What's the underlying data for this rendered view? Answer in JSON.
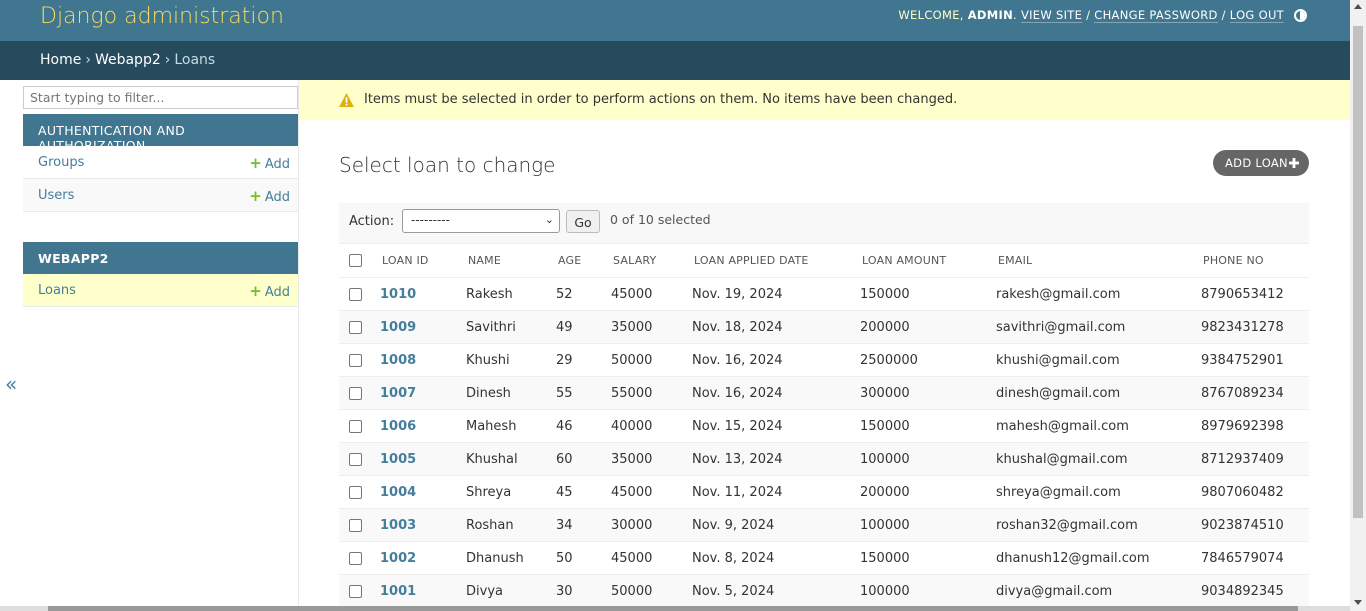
{
  "header": {
    "site_name": "Django administration",
    "welcome": "WELCOME, ",
    "username": "ADMIN",
    "view_site": "VIEW SITE",
    "change_password": "CHANGE PASSWORD",
    "log_out": "LOG OUT"
  },
  "breadcrumbs": {
    "home": "Home",
    "app": "Webapp2",
    "current": "Loans"
  },
  "sidebar": {
    "filter_placeholder": "Start typing to filter...",
    "apps": [
      {
        "caption": "AUTHENTICATION AND AUTHORIZATION",
        "models": [
          {
            "name": "Groups",
            "add": "Add"
          },
          {
            "name": "Users",
            "add": "Add"
          }
        ]
      },
      {
        "caption": "WEBAPP2",
        "models": [
          {
            "name": "Loans",
            "add": "Add"
          }
        ]
      }
    ],
    "collapse_icon": "«"
  },
  "message": {
    "text": "Items must be selected in order to perform actions on them. No items have been changed."
  },
  "content": {
    "title": "Select loan to change",
    "add_button": "ADD LOAN",
    "action_label": "Action:",
    "action_selected": "---------",
    "go_label": "Go",
    "selected_count": "0 of 10 selected"
  },
  "table": {
    "headers": [
      "LOAN ID",
      "NAME",
      "AGE",
      "SALARY",
      "LOAN APPLIED DATE",
      "LOAN AMOUNT",
      "EMAIL",
      "PHONE NO"
    ],
    "rows": [
      [
        "1010",
        "Rakesh",
        "52",
        "45000",
        "Nov. 19, 2024",
        "150000",
        "rakesh@gmail.com",
        "8790653412"
      ],
      [
        "1009",
        "Savithri",
        "49",
        "35000",
        "Nov. 18, 2024",
        "200000",
        "savithri@gmail.com",
        "9823431278"
      ],
      [
        "1008",
        "Khushi",
        "29",
        "50000",
        "Nov. 16, 2024",
        "2500000",
        "khushi@gmail.com",
        "9384752901"
      ],
      [
        "1007",
        "Dinesh",
        "55",
        "55000",
        "Nov. 16, 2024",
        "300000",
        "dinesh@gmail.com",
        "8767089234"
      ],
      [
        "1006",
        "Mahesh",
        "46",
        "40000",
        "Nov. 15, 2024",
        "150000",
        "mahesh@gmail.com",
        "8979692398"
      ],
      [
        "1005",
        "Khushal",
        "60",
        "35000",
        "Nov. 13, 2024",
        "100000",
        "khushal@gmail.com",
        "8712937409"
      ],
      [
        "1004",
        "Shreya",
        "45",
        "45000",
        "Nov. 11, 2024",
        "200000",
        "shreya@gmail.com",
        "9807060482"
      ],
      [
        "1003",
        "Roshan",
        "34",
        "30000",
        "Nov. 9, 2024",
        "100000",
        "roshan32@gmail.com",
        "9023874510"
      ],
      [
        "1002",
        "Dhanush",
        "50",
        "45000",
        "Nov. 8, 2024",
        "150000",
        "dhanush12@gmail.com",
        "7846579074"
      ],
      [
        "1001",
        "Divya",
        "30",
        "50000",
        "Nov. 5, 2024",
        "100000",
        "divya@gmail.com",
        "9034892345"
      ]
    ]
  },
  "colors": {
    "header_bg": "#417690",
    "breadcrumbs_bg": "#264b5d",
    "site_name": "#f5dd5d",
    "link": "#447e9b",
    "add_plus": "#70bf2b",
    "message_bg": "#ffffcc"
  }
}
